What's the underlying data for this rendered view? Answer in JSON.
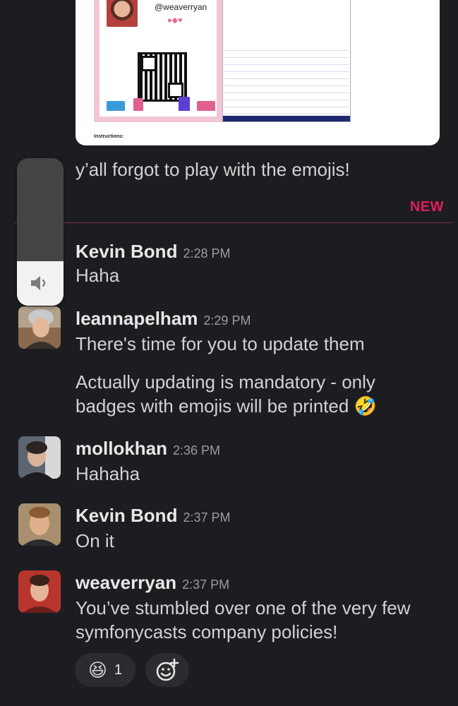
{
  "attachment": {
    "handle": "@weaverryan",
    "instructions_label": "Instructions:"
  },
  "volume_overlay": {
    "level_percent": 30,
    "icon": "speaker-icon"
  },
  "continuation_message": "y’all forgot to play with the emojis!",
  "new_divider": {
    "label": "NEW",
    "color": "#e01e5a"
  },
  "messages": [
    {
      "author": "Kevin Bond",
      "time": "2:28 PM",
      "lines": [
        "Haha"
      ]
    },
    {
      "author": "leannapelham",
      "time": "2:29 PM",
      "lines": [
        "There's time for you to update them"
      ]
    },
    {
      "lines": [
        "Actually updating is mandatory - only",
        "badges with emojis will be printed 🤣"
      ]
    },
    {
      "author": "mollokhan",
      "time": "2:36 PM",
      "lines": [
        "Hahaha"
      ]
    },
    {
      "author": "Kevin Bond",
      "time": "2:37 PM",
      "lines": [
        "On it"
      ]
    },
    {
      "author": "weaverryan",
      "time": "2:37 PM",
      "lines": [
        "You’ve stumbled over one of the very few",
        "symfonycasts company policies!"
      ]
    }
  ],
  "reactions": [
    {
      "emoji": "😆",
      "count": "1"
    }
  ],
  "add_reaction": {
    "icon": "add-reaction-icon"
  },
  "colors": {
    "background": "#1b1d21",
    "text": "#d1d2d3",
    "timestamp": "#9b9c9e",
    "new_accent": "#e01e5a"
  }
}
